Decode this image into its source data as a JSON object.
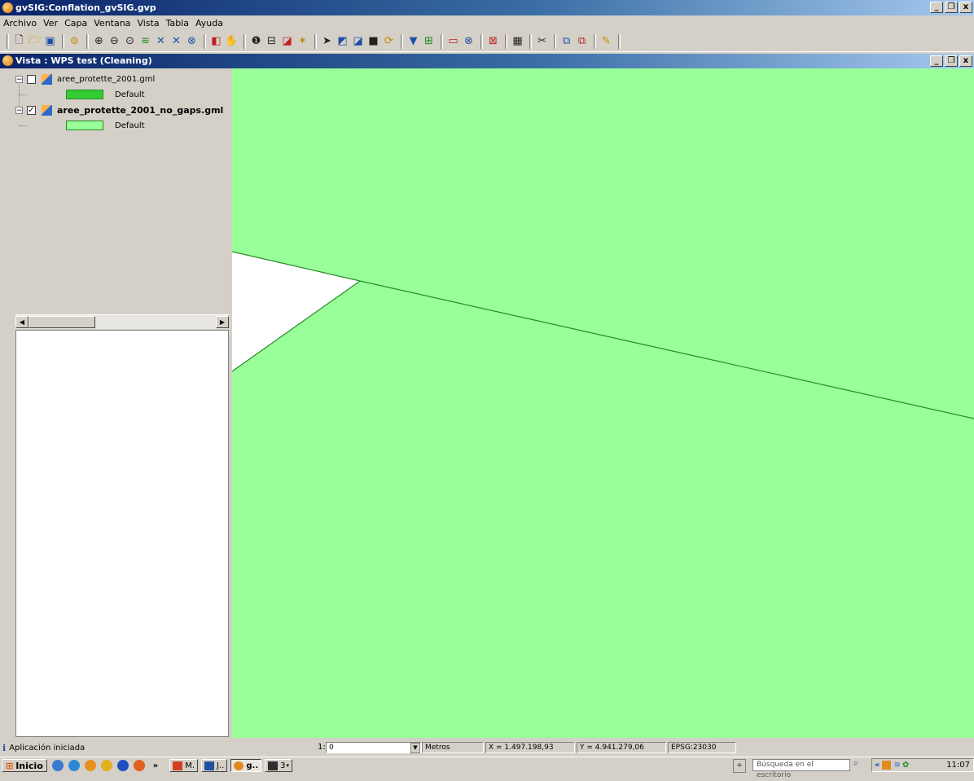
{
  "app": {
    "title": "gvSIG:Conflation_gvSIG.gvp",
    "controls": {
      "minimize": "_",
      "maximize": "❐",
      "close": "x"
    }
  },
  "menu": [
    "Archivo",
    "Ver",
    "Capa",
    "Ventana",
    "Vista",
    "Tabla",
    "Ayuda"
  ],
  "toolbar": {
    "icons": [
      "new-document-icon",
      "open-folder-icon",
      "save-icon",
      "add-layer-icon",
      "zoom-in-icon",
      "zoom-out-icon",
      "zoom-previous-icon",
      "zoom-full-icon",
      "zoom-extents-icon",
      "zoom-select-icon",
      "zoom-layer-icon",
      "locator-icon",
      "pan-icon",
      "info-icon",
      "measure-distance-icon",
      "measure-area-icon",
      "hyperlink-icon",
      "select-pointer-icon",
      "select-rectangle-icon",
      "select-polygon-icon",
      "select-layer-icon",
      "clear-selection-icon",
      "filter-icon",
      "table-icon",
      "graphic-rectangle-icon",
      "zoom-selection-icon",
      "geoprocessing-icon",
      "map-icon",
      "tools-icon",
      "copy-icon",
      "paste-icon",
      "edit-icon"
    ]
  },
  "view": {
    "title": "Vista : WPS test (Cleaning)",
    "layers": [
      {
        "name": "aree_protette_2001.gml",
        "checked": false,
        "legend_label": "Default",
        "legend_color": "#33cc33",
        "bold": false
      },
      {
        "name": "aree_protette_2001_no_gaps.gml",
        "checked": true,
        "legend_label": "Default",
        "legend_color": "#99ff99",
        "bold": true
      }
    ],
    "map_fill_color": "#99ff99",
    "boundary_color": "#2a8a2a"
  },
  "status": {
    "message": "Aplicación iniciada",
    "scale_prefix": "1:",
    "scale_value": "0",
    "units": "Metros",
    "x": "X = 1.497.198,93",
    "y": "Y = 4.941.279,06",
    "crs": "EPSG:23030"
  },
  "taskbar": {
    "start": "Inicio",
    "chevron": "»",
    "buttons": [
      "M.",
      "J..",
      "g..",
      "3"
    ],
    "search_placeholder": "Búsqueda en el escritorio",
    "tray_chevron": "«",
    "clock": "11:07"
  }
}
